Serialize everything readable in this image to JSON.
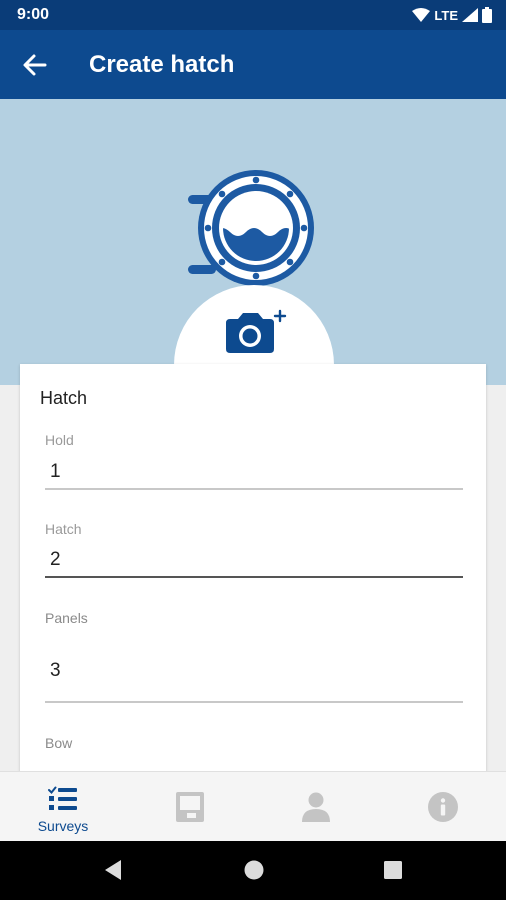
{
  "status_bar": {
    "time": "9:00",
    "network": "LTE",
    "icons": [
      "wifi-icon",
      "signal-icon",
      "battery-icon"
    ]
  },
  "app_bar": {
    "title": "Create hatch",
    "back_icon": "arrow-left-icon"
  },
  "hero": {
    "illustration": "porthole-icon",
    "photo_button_icon": "camera-plus-icon"
  },
  "form": {
    "section_title": "Hatch",
    "fields": [
      {
        "label": "Hold",
        "value": "1"
      },
      {
        "label": "Hatch",
        "value": "2"
      },
      {
        "label": "Panels",
        "value": "3"
      },
      {
        "label": "Bow",
        "value": ""
      }
    ]
  },
  "bottom_nav": {
    "items": [
      {
        "icon": "list-check-icon",
        "label": "Surveys",
        "active": true
      },
      {
        "icon": "hatch-icon",
        "label": "",
        "active": false
      },
      {
        "icon": "person-icon",
        "label": "",
        "active": false
      },
      {
        "icon": "info-icon",
        "label": "",
        "active": false
      }
    ]
  },
  "system_nav": [
    "back-triangle-icon",
    "home-circle-icon",
    "recents-square-icon"
  ],
  "colors": {
    "primary": "#0d4a8f",
    "status_bar": "#0a3c78",
    "hero_bg": "#b4d0e1",
    "inactive_icon": "#c4c4c4"
  }
}
